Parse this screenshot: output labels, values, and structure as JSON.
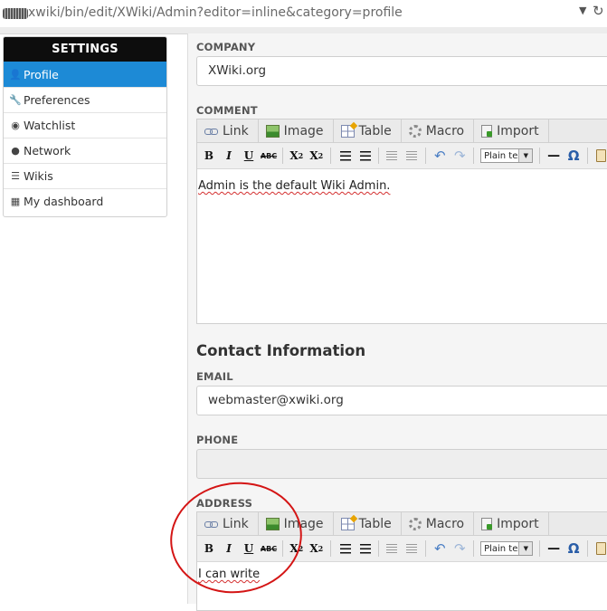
{
  "browser": {
    "url": "xwiki/bin/edit/XWiki/Admin?editor=inline&category=profile",
    "dropdown_icon": "chevron-down-icon",
    "reload_icon": "reload-icon"
  },
  "sidebar": {
    "title": "SETTINGS",
    "items": [
      {
        "label": "Profile",
        "icon": "user-icon",
        "active": true
      },
      {
        "label": "Preferences",
        "icon": "wrench-icon",
        "active": false
      },
      {
        "label": "Watchlist",
        "icon": "eye-icon",
        "active": false
      },
      {
        "label": "Network",
        "icon": "globe-icon",
        "active": false
      },
      {
        "label": "Wikis",
        "icon": "list-icon",
        "active": false
      },
      {
        "label": "My dashboard",
        "icon": "grid-icon",
        "active": false
      }
    ]
  },
  "form": {
    "company": {
      "label": "COMPANY",
      "value": "XWiki.org"
    },
    "comment": {
      "label": "COMMENT",
      "value": "Admin is the default Wiki Admin."
    },
    "contact_heading": "Contact Information",
    "email": {
      "label": "EMAIL",
      "value": "webmaster@xwiki.org"
    },
    "phone": {
      "label": "PHONE",
      "value": ""
    },
    "address": {
      "label": "ADDRESS",
      "value": "I can write"
    }
  },
  "editor": {
    "tabs": [
      "Link",
      "Image",
      "Table",
      "Macro",
      "Import"
    ],
    "format_select": "Plain text",
    "buttons": {
      "bold": "B",
      "italic": "I",
      "underline": "U",
      "strike": "ABC",
      "subscript_base": "X",
      "subscript_mark": "2",
      "superscript_base": "X",
      "superscript_mark": "2",
      "hr": "—",
      "special_char": "Ω"
    }
  },
  "colors": {
    "accent": "#1d8ad6",
    "sidebar_header": "#0d0d0d",
    "annotation": "#d41515"
  }
}
